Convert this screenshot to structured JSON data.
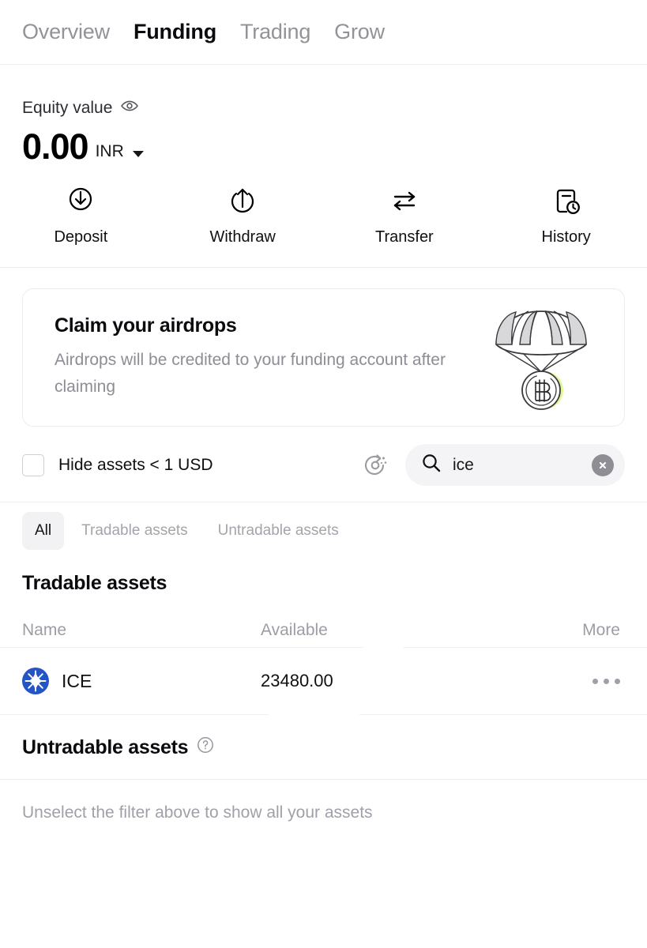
{
  "topnav": {
    "tabs": [
      {
        "label": "Overview",
        "active": false
      },
      {
        "label": "Funding",
        "active": true
      },
      {
        "label": "Trading",
        "active": false
      },
      {
        "label": "Grow",
        "active": false
      }
    ]
  },
  "equity": {
    "label": "Equity value",
    "eye_icon": "eye-icon",
    "value": "0.00",
    "currency": "INR",
    "currency_caret_icon": "chevron-down-icon"
  },
  "actions": [
    {
      "label": "Deposit",
      "icon": "arrow-down-circle-icon"
    },
    {
      "label": "Withdraw",
      "icon": "arrow-up-circle-icon"
    },
    {
      "label": "Transfer",
      "icon": "transfer-arrows-icon"
    },
    {
      "label": "History",
      "icon": "document-clock-icon"
    }
  ],
  "airdrop": {
    "title": "Claim your airdrops",
    "subtitle": "Airdrops will be credited to your funding account after claiming",
    "illustration": "parachute-bitcoin-illustration",
    "glow_color": "#c6f442"
  },
  "filters": {
    "hide_small_assets_label": "Hide assets < 1 USD",
    "hide_small_assets_checked": false,
    "checkbox_icon": "checkbox-unchecked-icon",
    "discover_icon": "sparkle-circle-icon",
    "search": {
      "icon": "search-icon",
      "value": "ice",
      "placeholder": "Search",
      "clear_icon": "close-circle-icon"
    }
  },
  "segments": [
    {
      "label": "All",
      "active": true
    },
    {
      "label": "Tradable assets",
      "active": false
    },
    {
      "label": "Untradable assets",
      "active": false
    }
  ],
  "tradable": {
    "heading": "Tradable assets",
    "columns": {
      "name": "Name",
      "available": "Available",
      "more": "More"
    },
    "rows": [
      {
        "symbol": "ICE",
        "icon": "ice-coin-icon",
        "icon_color": "#2555c4",
        "available": "23480.00",
        "more_icon": "more-dots-icon"
      }
    ]
  },
  "untradable": {
    "heading": "Untradable assets",
    "help_icon": "question-circle-icon",
    "empty_message": "Unselect the filter above to show all your assets"
  }
}
